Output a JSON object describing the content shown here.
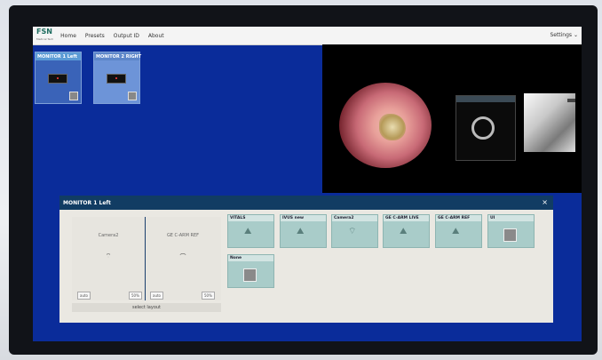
{
  "navbar": {
    "logo": "FSN",
    "logo_sub": "Medical Tech",
    "items": [
      "Home",
      "Presets",
      "Output ID",
      "About"
    ],
    "settings_label": "Settings",
    "settings_caret": "⌄"
  },
  "monitors": [
    {
      "label": "MONITOR 1 Left",
      "selected": true
    },
    {
      "label": "MONITOR 2 RIGHT",
      "selected": false
    }
  ],
  "dialog": {
    "title": "MONITOR 1 Left",
    "close_icon": "×",
    "layout": {
      "left": {
        "source": "Camera2",
        "icon": "camera-icon",
        "btn_a": "auto",
        "btn_b": "50%"
      },
      "right": {
        "source": "GE C-ARM REF",
        "icon": "arm-icon",
        "btn_a": "auto",
        "btn_b": "50%"
      },
      "select_label": "select layout"
    },
    "sources": [
      {
        "label": "VITALS",
        "icon": "image-icon"
      },
      {
        "label": "IVUS new",
        "icon": "image-icon"
      },
      {
        "label": "Camera2",
        "icon": "camera-icon"
      },
      {
        "label": "GE C-ARM LIVE",
        "icon": "image-icon"
      },
      {
        "label": "GE C-ARM REF",
        "icon": "image-icon"
      },
      {
        "label": "UI",
        "icon": "square-icon"
      },
      {
        "label": "None",
        "icon": "square-icon"
      }
    ]
  },
  "colors": {
    "accent": "#113c63",
    "screen_bg": "#0a2c9a",
    "tile_bg": "#a9ccc9"
  }
}
